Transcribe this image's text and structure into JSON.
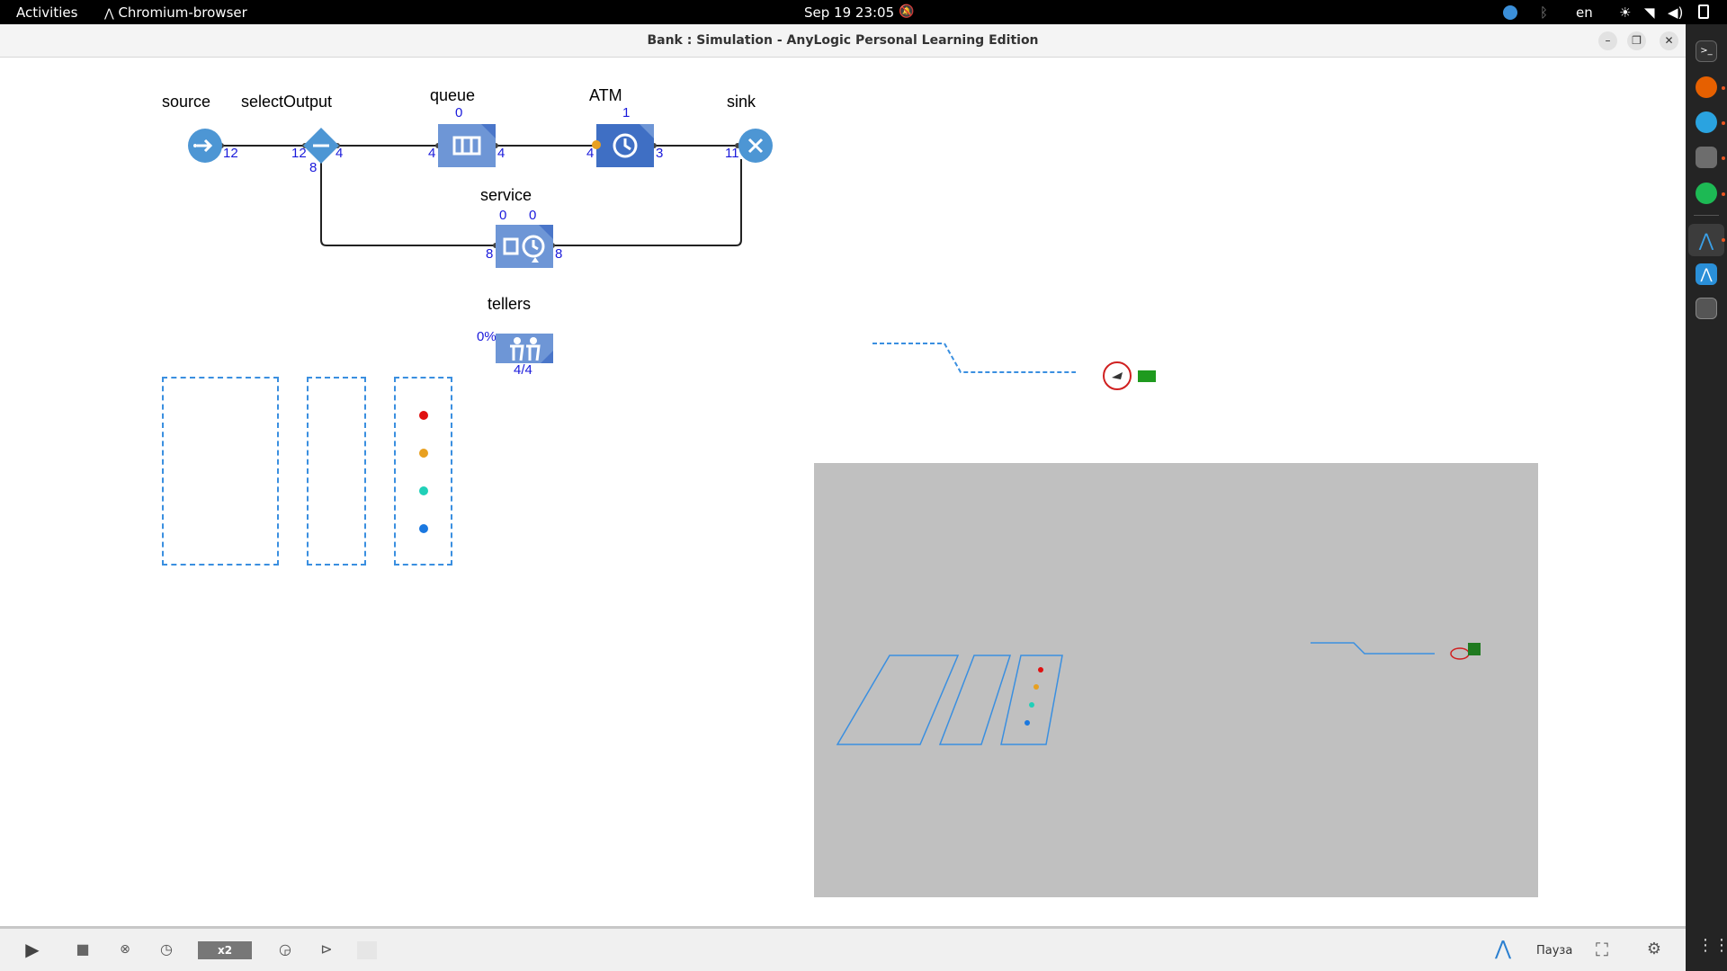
{
  "topbar": {
    "activities": "Activities",
    "app_name": "Chromium-browser",
    "clock": "Sep 19  23:05",
    "language": "en"
  },
  "window": {
    "title": "Bank : Simulation - AnyLogic Personal Learning Edition"
  },
  "flowchart": {
    "blocks": {
      "source": {
        "label": "source",
        "out": "12"
      },
      "select_output": {
        "label": "selectOutput",
        "in": "12",
        "out_true": "4",
        "out_false": "8"
      },
      "queue": {
        "label": "queue",
        "in": "4",
        "out": "4",
        "count": "0"
      },
      "atm": {
        "label": "ATM",
        "in": "4",
        "out": "3",
        "count": "1"
      },
      "sink": {
        "label": "sink",
        "in": "11"
      },
      "service": {
        "label": "service",
        "in": "8",
        "out": "8",
        "queue_count": "0",
        "delay_count": "0"
      },
      "tellers": {
        "label": "tellers",
        "utilization": "0%",
        "available": "4/4"
      }
    }
  },
  "toolbar": {
    "speed": "x2",
    "status": "Пауза"
  },
  "colors": {
    "block_blue": "#4a76c9",
    "block_light": "#6e96d6",
    "source_sink": "#4d96d4",
    "port_text": "#1a1adb",
    "area_border": "#3a8fe0",
    "panel_3d": "#c0c0c0",
    "dot_red": "#e01010",
    "dot_orange": "#e8a020",
    "dot_teal": "#20d0b8",
    "dot_blue": "#1a78e0"
  }
}
